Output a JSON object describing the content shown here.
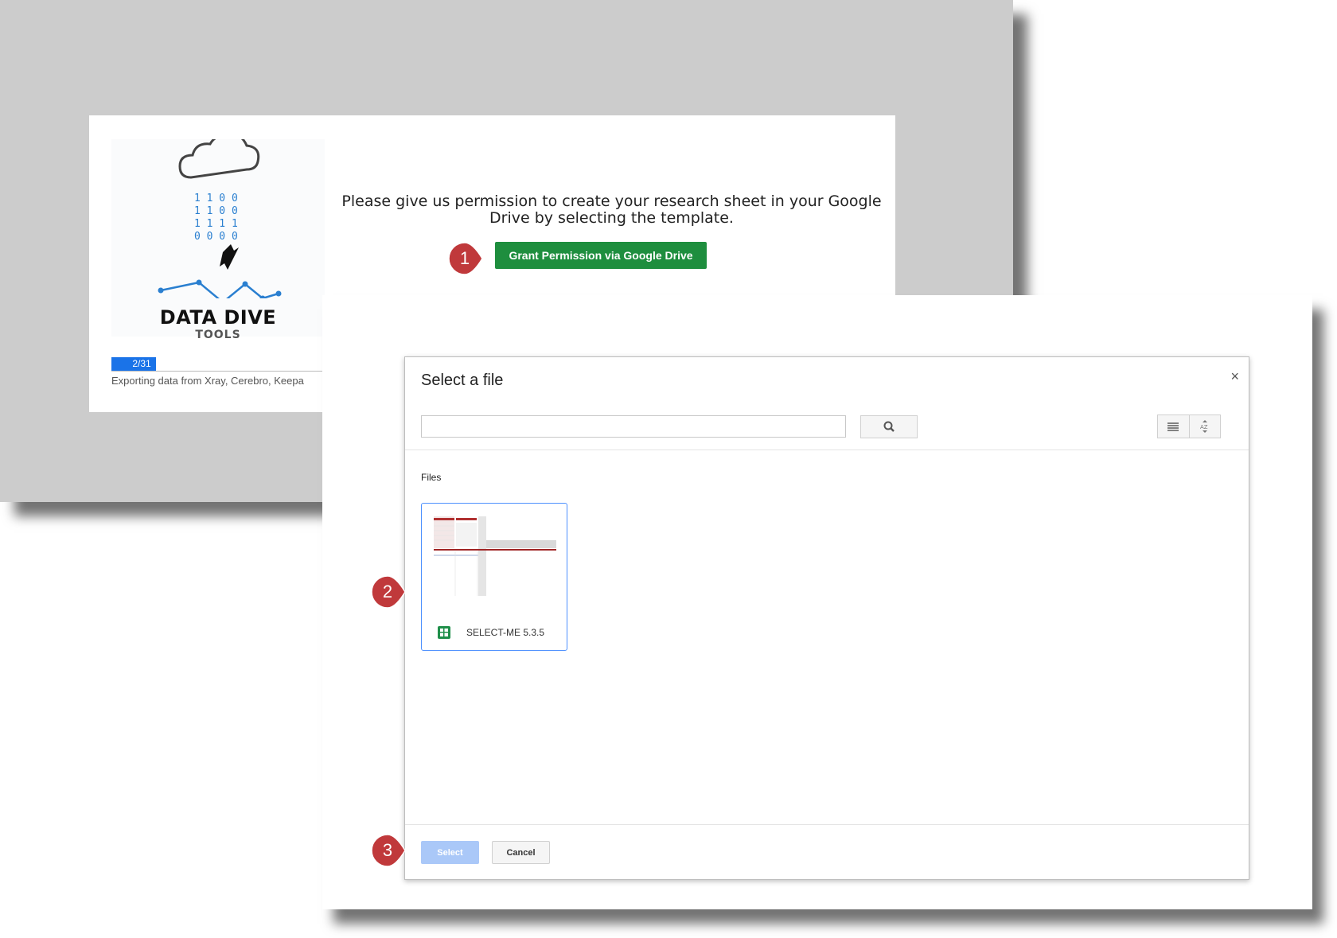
{
  "background_window": {
    "logo": {
      "title": "DATA DIVE",
      "subtitle": "TOOLS",
      "binary_rows": [
        "1 1 0 0",
        "1 1 0 0",
        "1 1 1 1",
        "0 0 0 0"
      ]
    },
    "progress": {
      "label": "2/31",
      "fraction": 0.0645
    },
    "export_text": "Exporting data from Xray, Cerebro, Keepa",
    "permission_text": "Please give us permission to create your research sheet in your Google Drive by selecting the template.",
    "grant_button": "Grant Permission via Google Drive"
  },
  "dialog": {
    "title": "Select a file",
    "close_glyph": "×",
    "search": {
      "placeholder": "",
      "value": ""
    },
    "section_label": "Files",
    "files": [
      {
        "name": "SELECT-ME 5.3.5"
      }
    ],
    "buttons": {
      "select": "Select",
      "cancel": "Cancel"
    }
  },
  "callouts": [
    "1",
    "2",
    "3"
  ],
  "colors": {
    "grant_green": "#1e8e3e",
    "callout_red": "#c0393b",
    "select_blue_disabled": "#aac8f8",
    "progress_blue": "#1a73e8"
  }
}
